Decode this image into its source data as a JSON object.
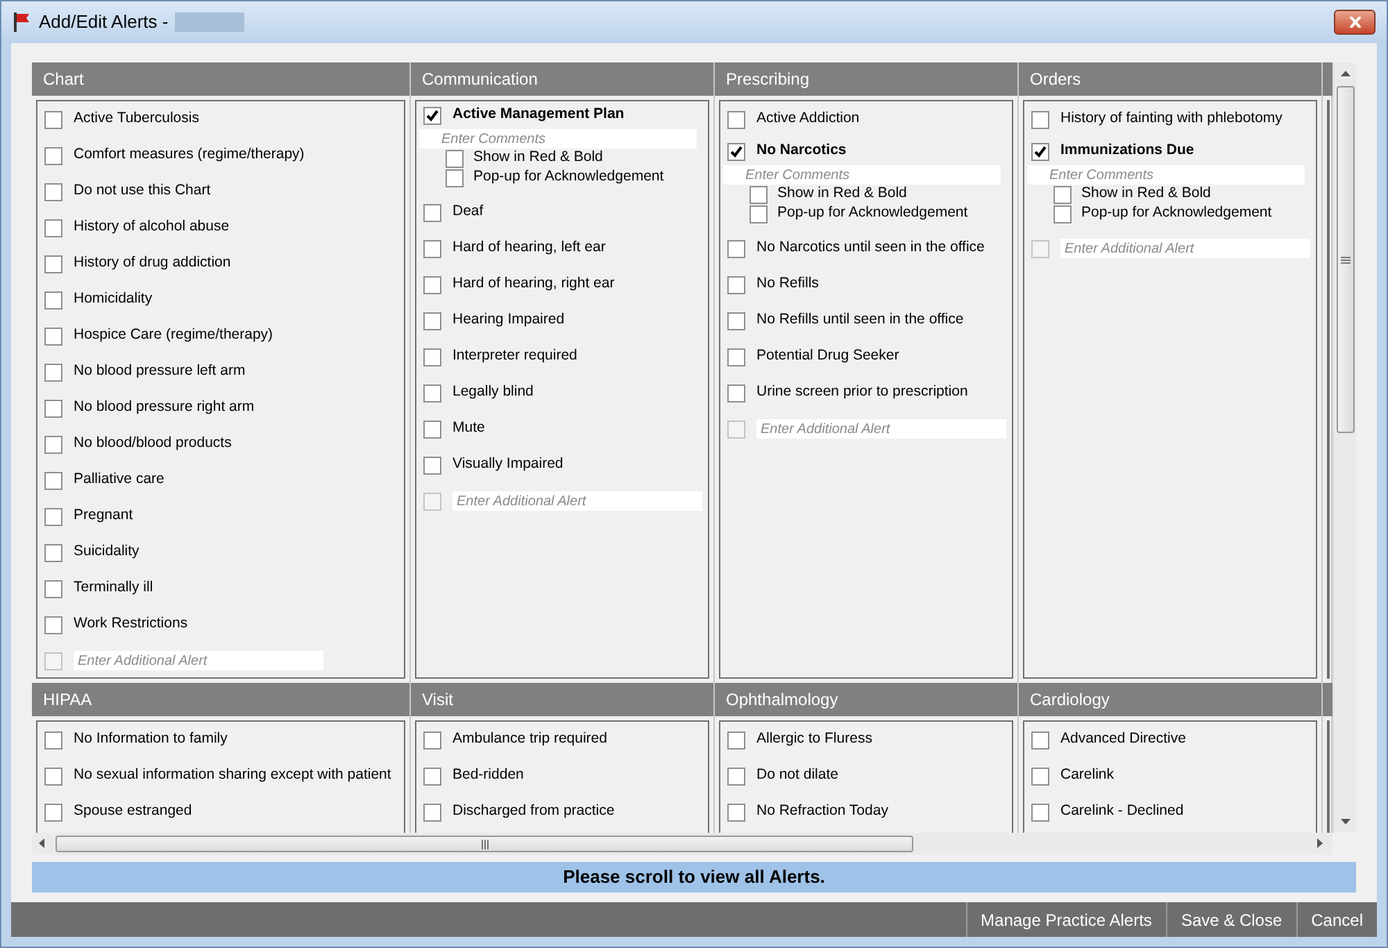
{
  "window": {
    "title": "Add/Edit Alerts -"
  },
  "sections": [
    {
      "title": "Chart",
      "items": [
        {
          "label": "Active Tuberculosis",
          "checked": false
        },
        {
          "label": "Comfort measures (regime/therapy)",
          "checked": false
        },
        {
          "label": "Do not use this Chart",
          "checked": false
        },
        {
          "label": "History of alcohol abuse",
          "checked": false
        },
        {
          "label": "History of drug addiction",
          "checked": false
        },
        {
          "label": "Homicidality",
          "checked": false
        },
        {
          "label": "Hospice Care (regime/therapy)",
          "checked": false
        },
        {
          "label": "No blood pressure left arm",
          "checked": false
        },
        {
          "label": "No blood pressure right arm",
          "checked": false
        },
        {
          "label": "No blood/blood products",
          "checked": false
        },
        {
          "label": "Palliative care",
          "checked": false
        },
        {
          "label": "Pregnant",
          "checked": false
        },
        {
          "label": "Suicidality",
          "checked": false
        },
        {
          "label": "Terminally ill",
          "checked": false
        },
        {
          "label": "Work Restrictions",
          "checked": false
        }
      ],
      "additional": {
        "placeholder": "Enter Additional Alert",
        "checked": false,
        "disabled": true
      }
    },
    {
      "title": "Communication",
      "items": [
        {
          "label": "Active Management Plan",
          "checked": true,
          "comment_placeholder": "Enter Comments",
          "options": [
            {
              "label": "Show in Red & Bold",
              "checked": false
            },
            {
              "label": "Pop-up for Acknowledgement",
              "checked": false
            }
          ]
        },
        {
          "label": "Deaf",
          "checked": false
        },
        {
          "label": "Hard of hearing, left ear",
          "checked": false
        },
        {
          "label": "Hard of hearing, right ear",
          "checked": false
        },
        {
          "label": "Hearing Impaired",
          "checked": false
        },
        {
          "label": "Interpreter required",
          "checked": false
        },
        {
          "label": "Legally blind",
          "checked": false
        },
        {
          "label": "Mute",
          "checked": false
        },
        {
          "label": "Visually Impaired",
          "checked": false
        }
      ],
      "additional": {
        "placeholder": "Enter Additional Alert",
        "checked": false,
        "disabled": true
      }
    },
    {
      "title": "Prescribing",
      "items": [
        {
          "label": "Active Addiction",
          "checked": false
        },
        {
          "label": "No Narcotics",
          "checked": true,
          "comment_placeholder": "Enter Comments",
          "options": [
            {
              "label": "Show in Red & Bold",
              "checked": false
            },
            {
              "label": "Pop-up for Acknowledgement",
              "checked": false
            }
          ]
        },
        {
          "label": "No Narcotics until seen in the office",
          "checked": false
        },
        {
          "label": "No Refills",
          "checked": false
        },
        {
          "label": "No Refills until seen in the office",
          "checked": false
        },
        {
          "label": "Potential Drug Seeker",
          "checked": false
        },
        {
          "label": "Urine screen prior to prescription",
          "checked": false
        }
      ],
      "additional": {
        "placeholder": "Enter Additional Alert",
        "checked": false,
        "disabled": true
      }
    },
    {
      "title": "Orders",
      "items": [
        {
          "label": "History of fainting with phlebotomy",
          "checked": false
        },
        {
          "label": "Immunizations Due",
          "checked": true,
          "comment_placeholder": "Enter Comments",
          "options": [
            {
              "label": "Show in Red & Bold",
              "checked": false
            },
            {
              "label": "Pop-up for Acknowledgement",
              "checked": false
            }
          ]
        }
      ],
      "additional": {
        "placeholder": "Enter Additional Alert",
        "checked": false,
        "disabled": true
      }
    },
    {
      "title": "HIPAA",
      "items": [
        {
          "label": "No Information to family",
          "checked": false
        },
        {
          "label": "No sexual information sharing except with patient",
          "checked": false
        },
        {
          "label": "Spouse estranged",
          "checked": false
        }
      ]
    },
    {
      "title": "Visit",
      "items": [
        {
          "label": "Ambulance trip required",
          "checked": false
        },
        {
          "label": "Bed-ridden",
          "checked": false
        },
        {
          "label": "Discharged from practice",
          "checked": false
        }
      ]
    },
    {
      "title": "Ophthalmology",
      "items": [
        {
          "label": "Allergic to Fluress",
          "checked": false
        },
        {
          "label": "Do not dilate",
          "checked": false
        },
        {
          "label": "No Refraction Today",
          "checked": false
        }
      ]
    },
    {
      "title": "Cardiology",
      "items": [
        {
          "label": "Advanced Directive",
          "checked": false
        },
        {
          "label": "Carelink",
          "checked": false
        },
        {
          "label": "Carelink - Declined",
          "checked": false
        }
      ]
    }
  ],
  "notice": "Please scroll to view all Alerts.",
  "buttons": [
    "Manage Practice Alerts",
    "Save & Close",
    "Cancel"
  ]
}
